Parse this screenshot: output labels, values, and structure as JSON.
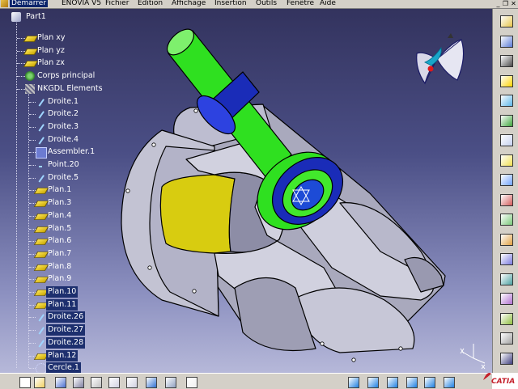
{
  "menubar": {
    "items": [
      "Démarrer",
      "ENOVIA V5",
      "Fichier",
      "Edition",
      "Affichage",
      "Insertion",
      "Outils",
      "Fenêtre",
      "Aide"
    ]
  },
  "tree": {
    "root": "Part1",
    "nodes": [
      {
        "label": "Plan xy",
        "icon": "plane-icon",
        "level": 1
      },
      {
        "label": "Plan yz",
        "icon": "plane-icon",
        "level": 1
      },
      {
        "label": "Plan zx",
        "icon": "plane-icon",
        "level": 1
      },
      {
        "label": "Corps principal",
        "icon": "body-icon",
        "level": 1
      },
      {
        "label": "NKGDL Elements",
        "icon": "geometrical-set-icon",
        "level": 1
      },
      {
        "label": "Droite.1",
        "icon": "line-icon",
        "level": 2
      },
      {
        "label": "Droite.2",
        "icon": "line-icon",
        "level": 2
      },
      {
        "label": "Droite.3",
        "icon": "line-icon",
        "level": 2
      },
      {
        "label": "Droite.4",
        "icon": "line-icon",
        "level": 2
      },
      {
        "label": "Assembler.1",
        "icon": "join-icon",
        "level": 2
      },
      {
        "label": "Point.20",
        "icon": "point-icon",
        "level": 2
      },
      {
        "label": "Droite.5",
        "icon": "line-icon",
        "level": 2
      },
      {
        "label": "Plan.1",
        "icon": "plane-icon",
        "level": 2
      },
      {
        "label": "Plan.3",
        "icon": "plane-icon",
        "level": 2
      },
      {
        "label": "Plan.4",
        "icon": "plane-icon",
        "level": 2
      },
      {
        "label": "Plan.5",
        "icon": "plane-icon",
        "level": 2
      },
      {
        "label": "Plan.6",
        "icon": "plane-icon",
        "level": 2
      },
      {
        "label": "Plan.7",
        "icon": "plane-icon",
        "level": 2
      },
      {
        "label": "Plan.8",
        "icon": "plane-icon",
        "level": 2
      },
      {
        "label": "Plan.9",
        "icon": "plane-icon",
        "level": 2
      },
      {
        "label": "Plan.10",
        "icon": "plane-icon",
        "level": 2,
        "selected": true
      },
      {
        "label": "Plan.11",
        "icon": "plane-icon",
        "level": 2,
        "selected": true
      },
      {
        "label": "Droite.26",
        "icon": "line-icon",
        "level": 2,
        "selected": true
      },
      {
        "label": "Droite.27",
        "icon": "line-icon",
        "level": 2,
        "selected": true
      },
      {
        "label": "Droite.28",
        "icon": "line-icon",
        "level": 2,
        "selected": true
      },
      {
        "label": "Plan.12",
        "icon": "plane-icon",
        "level": 2,
        "selected": true
      },
      {
        "label": "Cercle.1",
        "icon": "circle-icon",
        "level": 2,
        "selected": true
      }
    ]
  },
  "colors": {
    "background_top": "#33335e",
    "background_bottom": "#b6b8d9",
    "part_gray": "#c3c3d3",
    "shaft_green": "#2fe020",
    "ring_blue": "#1a2cb8",
    "inner_yellow": "#d8cc10",
    "tree_selection": "#1d2f6e",
    "menu_active": "#0a246a"
  },
  "toolbars": {
    "right": [
      "workbench-icon",
      "compass-icon",
      "sketch-icon",
      "pad-icon",
      "pocket-icon",
      "shaft-icon",
      "hole-icon",
      "fillet-icon",
      "chamfer-icon",
      "draft-icon",
      "shell-icon",
      "thickness-icon",
      "split-icon",
      "boolean-icon",
      "transform-icon",
      "pattern-icon",
      "measure-icon",
      "scroll-down-icon"
    ],
    "bottom": [
      "new-icon",
      "open-icon",
      "save-icon",
      "print-icon",
      "cut-icon",
      "copy-icon",
      "paste-icon",
      "undo-icon",
      "redo-icon",
      "whats-this-icon",
      "fly-mode-icon",
      "fit-all-icon",
      "pan-icon",
      "rotate-icon",
      "zoom-in-icon",
      "zoom-out-icon"
    ]
  },
  "logo": {
    "text": "CATIA"
  }
}
